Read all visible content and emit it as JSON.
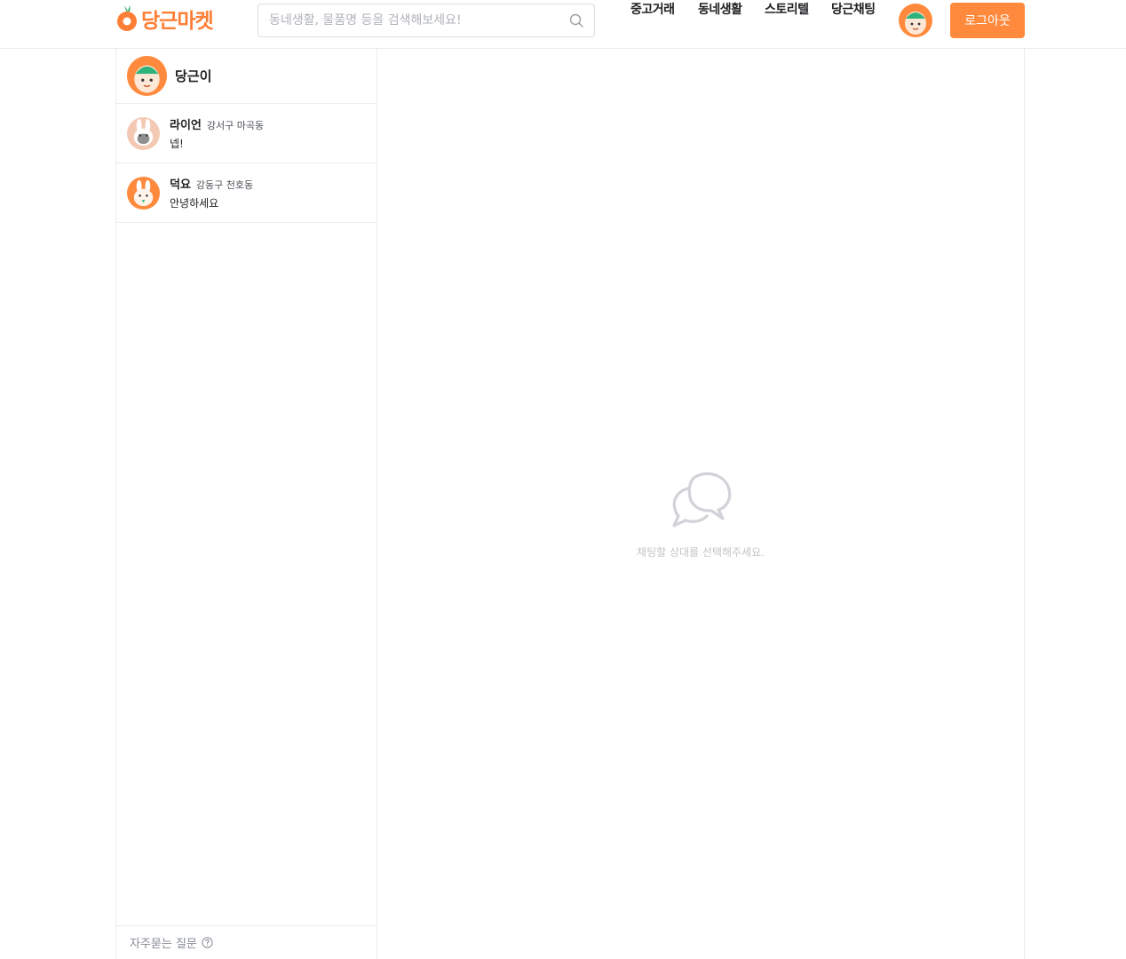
{
  "header": {
    "logo_text": "당근마켓",
    "search_placeholder": "동네생활, 물품명 등을 검색해보세요!",
    "nav": [
      "중고거래",
      "동네생활",
      "스토리텔",
      "당근채팅"
    ],
    "logout_label": "로그아웃"
  },
  "sidebar": {
    "me": {
      "name": "당근이",
      "avatar": "carrot-avatar-icon"
    },
    "chats": [
      {
        "name": "라이언",
        "location": "강서구 마곡동",
        "message": "넵!",
        "avatar": "rabbit-avatar-icon"
      },
      {
        "name": "덕요",
        "location": "강동구 천호동",
        "message": "안녕하세요",
        "avatar": "rabbit-carrot-avatar-icon"
      }
    ],
    "faq_label": "자주묻는 질문"
  },
  "main": {
    "empty_message": "채팅할 상대를 선택해주세요.",
    "empty_icon": "chat-bubbles-icon"
  },
  "colors": {
    "brand": "#ff7e36",
    "button": "#ff8a3d",
    "border": "#e9ecef",
    "muted": "#c2c4c8"
  }
}
